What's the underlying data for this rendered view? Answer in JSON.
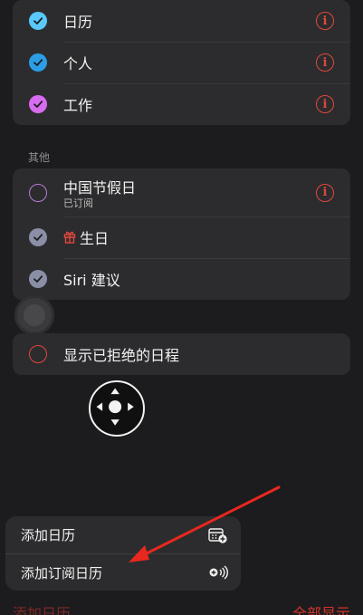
{
  "calendars": [
    {
      "label": "日历",
      "color": "#5ac8fa",
      "checked": true,
      "has_info": true
    },
    {
      "label": "个人",
      "color": "#2b9ee6",
      "checked": true,
      "has_info": true
    },
    {
      "label": "工作",
      "color": "#d86cf0",
      "checked": true,
      "has_info": true
    }
  ],
  "other": {
    "title": "其他",
    "items": [
      {
        "label": "中国节假日",
        "sub": "已订阅",
        "color": "#b77bd6",
        "checked": false,
        "has_info": true
      },
      {
        "label": "生日",
        "color": "#8a8fa6",
        "checked": true,
        "has_info": false,
        "icon": "gift-icon"
      },
      {
        "label": "Siri 建议",
        "color": "#8a8fa6",
        "checked": true,
        "has_info": false
      }
    ]
  },
  "show_declined": {
    "label": "显示已拒绝的日程",
    "color": "#e0483c",
    "checked": false
  },
  "menu": {
    "items": [
      {
        "label": "添加日历",
        "icon": "calendar-add-icon"
      },
      {
        "label": "添加订阅日历",
        "icon": "subscribe-broadcast-icon"
      }
    ]
  },
  "footer": {
    "left": "添加日历",
    "right": "全部显示"
  },
  "colors": {
    "accent": "#e0483c",
    "background": "#1c1c1e",
    "card": "#2c2c2e"
  }
}
